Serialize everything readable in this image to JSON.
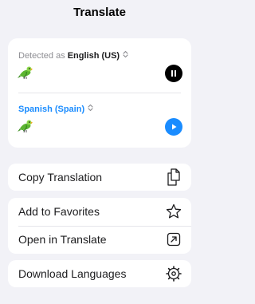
{
  "header": {
    "title": "Translate"
  },
  "translation": {
    "source": {
      "detected_prefix": "Detected as",
      "language": "English (US)",
      "text": "🦜",
      "control_icon": "pause-icon"
    },
    "target": {
      "language": "Spanish (Spain)",
      "text": "🦜",
      "control_icon": "play-icon"
    }
  },
  "actions": {
    "copy": {
      "label": "Copy Translation",
      "icon": "copy-icon"
    },
    "favorites": {
      "label": "Add to Favorites",
      "icon": "star-icon"
    },
    "open": {
      "label": "Open in Translate",
      "icon": "open-external-icon"
    },
    "download": {
      "label": "Download Languages",
      "icon": "gear-icon"
    }
  },
  "colors": {
    "accent": "#1a8cff",
    "background": "#f2f2f7",
    "card": "#ffffff",
    "secondary_text": "#8e8e93"
  }
}
